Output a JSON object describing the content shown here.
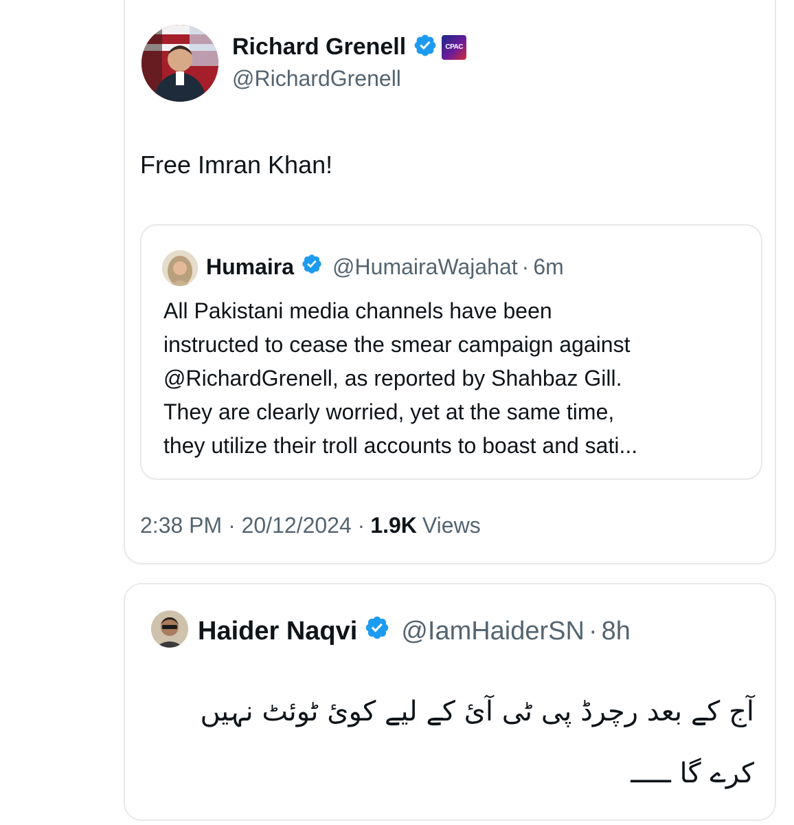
{
  "main_tweet": {
    "author_name": "Richard Grenell",
    "author_handle": "@RichardGrenell",
    "affiliate_badge_label": "CPAC",
    "text": "Free Imran Khan!",
    "timestamp": "2:38 PM · 20/12/2024 ·",
    "views_count": "1.9K",
    "views_label": "Views",
    "icons": [
      "verified-badge-icon",
      "cpac-affiliate-icon"
    ],
    "colors": {
      "verified_blue": "#1d9bf0",
      "secondary_text": "#536471"
    }
  },
  "quoted_tweet": {
    "author_name": "Humaira",
    "author_handle": "@HumairaWajahat",
    "separator": "·",
    "time": "6m",
    "body_lines": [
      "All Pakistani media channels have been",
      "instructed to cease the smear campaign against",
      "@RichardGrenell, as reported by Shahbaz Gill.",
      "They are clearly worried, yet at the same time,",
      "they utilize their troll accounts to boast and sati..."
    ]
  },
  "second_tweet": {
    "author_name": "Haider Naqvi",
    "author_handle": "@IamHaiderSN",
    "separator": "·",
    "time": "8h",
    "text": "آج کے بعد رچرڈ پی ٹی آئ کے لیے کوئ ٹوئٹ نہیں کرے گا ـــــ"
  }
}
